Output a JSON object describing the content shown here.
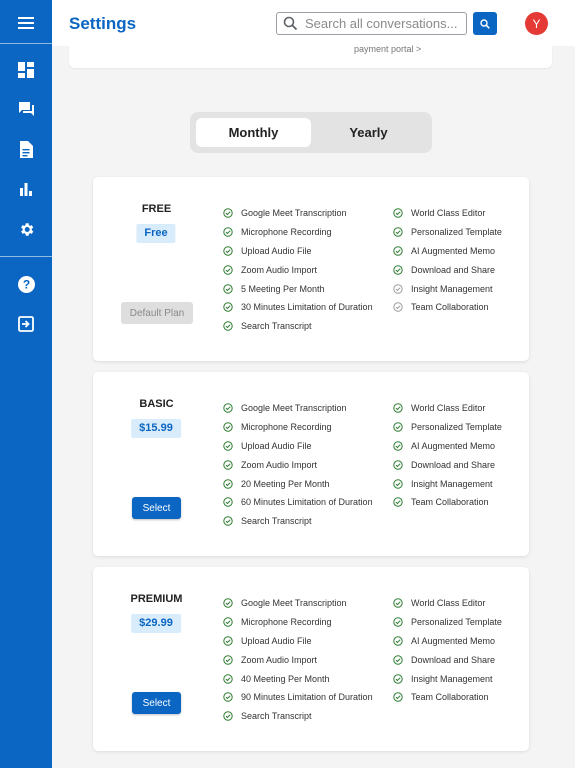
{
  "header": {
    "title": "Settings",
    "search_placeholder": "Search all conversations...",
    "avatar_initial": "Y"
  },
  "top_card": {
    "payment_link": "payment portal >"
  },
  "billing_toggle": {
    "monthly": "Monthly",
    "yearly": "Yearly",
    "selected": "Monthly"
  },
  "plans": [
    {
      "name": "FREE",
      "price": "Free",
      "button": "Default Plan",
      "left_features": [
        "Google Meet Transcription",
        "Microphone Recording",
        "Upload Audio File",
        "Zoom Audio Import",
        "5 Meeting Per Month",
        "30 Minutes Limitation of Duration",
        "Search Transcript"
      ],
      "right_features": [
        "World Class Editor",
        "Personalized Template",
        "AI Augmented Memo",
        "Download and Share",
        "Insight Management",
        "Team Collaboration"
      ]
    },
    {
      "name": "BASIC",
      "price": "$15.99",
      "button": "Select",
      "left_features": [
        "Google Meet Transcription",
        "Microphone Recording",
        "Upload Audio File",
        "Zoom Audio Import",
        "20 Meeting Per Month",
        "60 Minutes Limitation of Duration",
        "Search Transcript"
      ],
      "right_features": [
        "World Class Editor",
        "Personalized Template",
        "AI Augmented Memo",
        "Download and Share",
        "Insight Management",
        "Team Collaboration"
      ]
    },
    {
      "name": "PREMIUM",
      "price": "$29.99",
      "button": "Select",
      "left_features": [
        "Google Meet Transcription",
        "Microphone Recording",
        "Upload Audio File",
        "Zoom Audio Import",
        "40 Meeting Per Month",
        "90 Minutes Limitation of Duration",
        "Search Transcript"
      ],
      "right_features": [
        "World Class Editor",
        "Personalized Template",
        "AI Augmented Memo",
        "Download and Share",
        "Insight Management",
        "Team Collaboration"
      ]
    }
  ],
  "colors": {
    "brand": "#0a66c2",
    "check_enabled": "#2e7d32",
    "check_disabled": "#9e9e9e",
    "avatar": "#e53935"
  }
}
